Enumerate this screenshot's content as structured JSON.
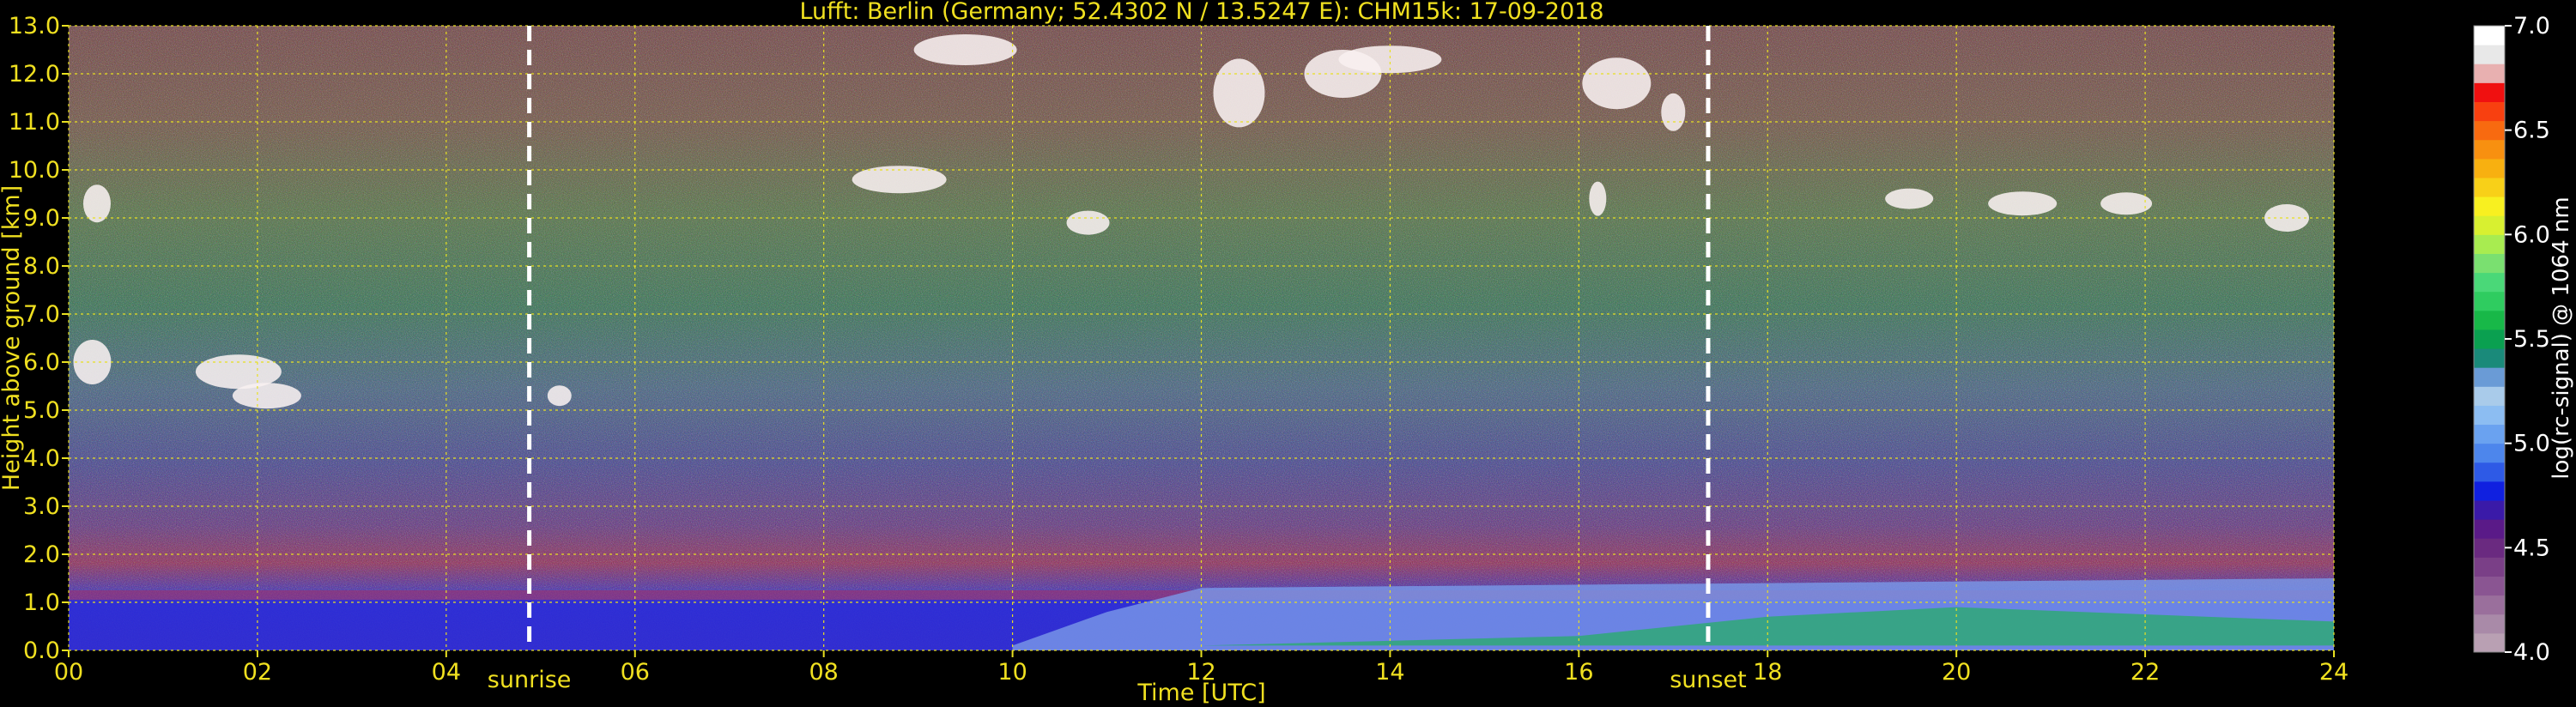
{
  "chart_data": {
    "type": "heatmap",
    "title": "Lufft: Berlin (Germany; 52.4302 N / 13.5247 E):    CHM15k: 17-09-2018",
    "xlabel": "Time [UTC]",
    "ylabel": "Height above ground [km]",
    "colorbar_label": "log(rc-signal) @ 1064 nm",
    "xlim": [
      0,
      24
    ],
    "ylim": [
      0,
      13
    ],
    "x_tick_labels": [
      "00",
      "02",
      "04",
      "06",
      "08",
      "10",
      "12",
      "14",
      "16",
      "18",
      "20",
      "22",
      "24"
    ],
    "y_tick_labels": [
      "0.0",
      "1.0",
      "2.0",
      "3.0",
      "4.0",
      "5.0",
      "6.0",
      "7.0",
      "8.0",
      "9.0",
      "10.0",
      "11.0",
      "12.0",
      "13.0"
    ],
    "colorbar_range": [
      4.0,
      7.0
    ],
    "colorbar_tick_labels": [
      "4.0",
      "4.5",
      "5.0",
      "5.5",
      "6.0",
      "6.5",
      "7.0"
    ],
    "grid": true,
    "colorbar_colors": [
      "#b9a0b3",
      "#a98aa8",
      "#9a6f9c",
      "#8a5592",
      "#7a3f87",
      "#6a2a80",
      "#5a1a88",
      "#3a1aa8",
      "#1020e0",
      "#2e5ae6",
      "#4d86ec",
      "#6aa2f0",
      "#8cbdf2",
      "#a9cbea",
      "#6a9bd6",
      "#1a8a7a",
      "#0aa050",
      "#18b848",
      "#2fcc60",
      "#4ad878",
      "#7ae070",
      "#a8ec50",
      "#d8f030",
      "#f8f020",
      "#f8d018",
      "#f8b010",
      "#f89010",
      "#f86a10",
      "#f84010",
      "#f01010",
      "#e8b0b0",
      "#e8e8e8",
      "#ffffff"
    ],
    "events": [
      {
        "label": "sunrise",
        "x": 4.88
      },
      {
        "label": "sunset",
        "x": 17.37
      }
    ]
  }
}
